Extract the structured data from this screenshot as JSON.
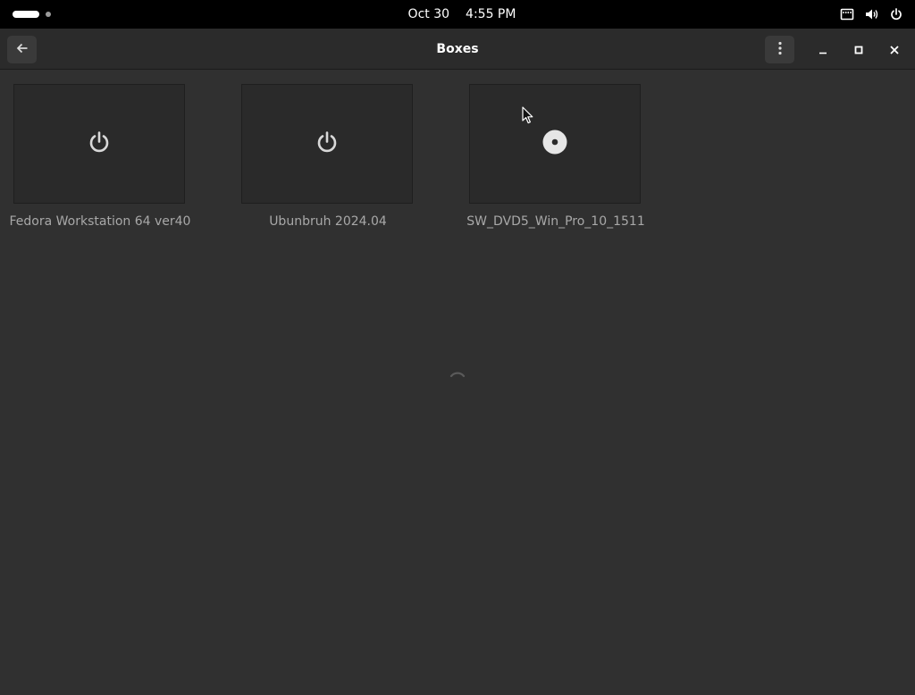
{
  "topbar": {
    "date": "Oct 30",
    "time": "4:55 PM",
    "icons": [
      "network-wired-icon",
      "volume-icon",
      "power-icon"
    ]
  },
  "headerbar": {
    "title": "Boxes",
    "buttons": [
      "back-arrow-icon",
      "kebab-menu-icon",
      "minimize-icon",
      "maximize-icon",
      "close-icon"
    ]
  },
  "machines": [
    {
      "name": "Fedora Workstation 64 ver40",
      "state_icon": "power-icon"
    },
    {
      "name": "Ubunbruh 2024.04",
      "state_icon": "power-icon"
    },
    {
      "name": "SW_DVD5_Win_Pro_10_1511",
      "state_icon": "disc-icon"
    }
  ],
  "colors": {
    "background": "#303030",
    "topbar": "#000000",
    "headerbar": "#2b2b2b",
    "thumbnail": "#2a2a2a",
    "label": "#a8a8a8"
  }
}
